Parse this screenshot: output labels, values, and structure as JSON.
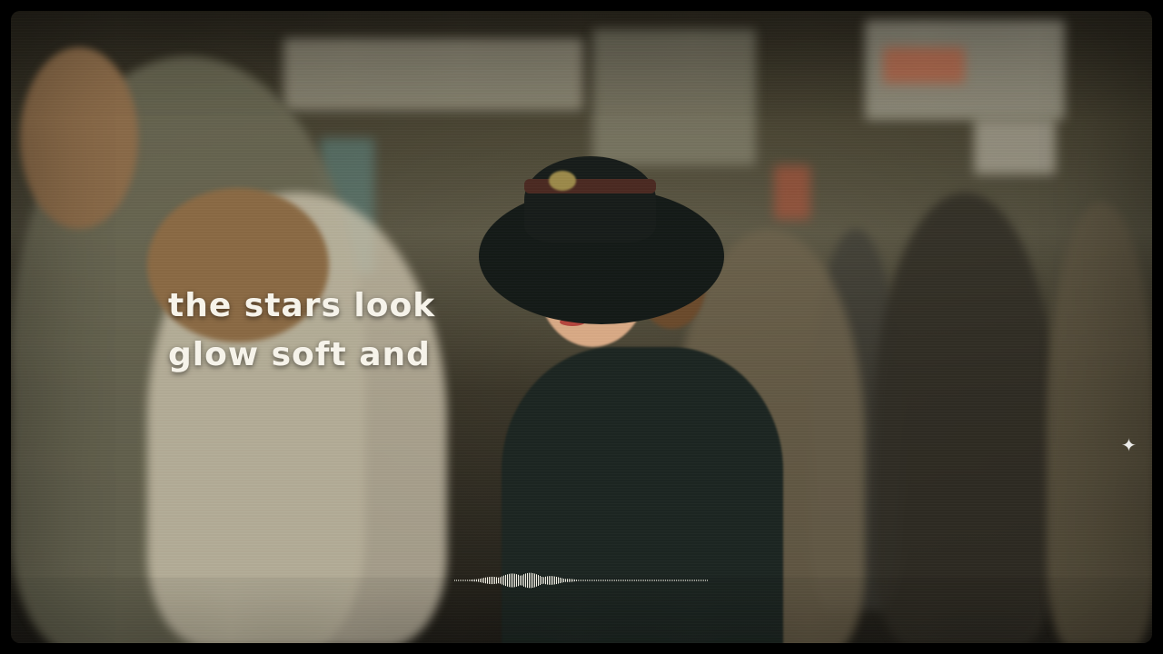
{
  "lyrics": {
    "line1": "the stars look",
    "line2": "glow soft and"
  },
  "visualizer": {
    "type": "waveform",
    "color": "#f4f1e6",
    "progress_fraction": 0.27
  },
  "overlay_icons": {
    "sparkle": "sparkle-icon"
  },
  "colors": {
    "frame": "#000000",
    "text": "#f6f3ea"
  }
}
